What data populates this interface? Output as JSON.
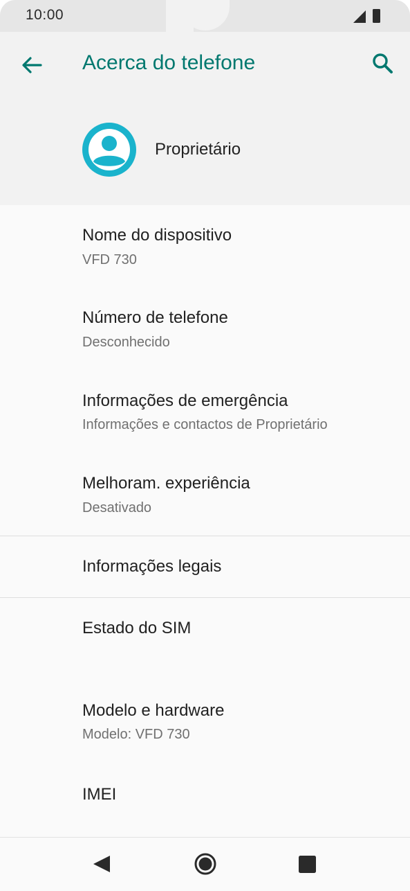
{
  "status_bar": {
    "time": "10:00"
  },
  "header": {
    "title": "Acerca do telefone",
    "back_icon": "arrow-left-icon",
    "search_icon": "search-icon",
    "accent_color": "#00786f"
  },
  "owner": {
    "name": "Proprietário",
    "avatar_icon": "account-circle-icon",
    "avatar_color": "#1ab3cc"
  },
  "items": [
    {
      "title": "Nome do dispositivo",
      "subtitle": "VFD 730"
    },
    {
      "title": "Número de telefone",
      "subtitle": "Desconhecido"
    },
    {
      "title": "Informações de emergência",
      "subtitle": "Informações e contactos de Proprietário"
    },
    {
      "title": "Melhoram. experiência",
      "subtitle": "Desativado"
    },
    {
      "title": "Informações legais",
      "subtitle": ""
    },
    {
      "title": "Estado do SIM",
      "subtitle": ""
    },
    {
      "title": "Modelo e hardware",
      "subtitle": "Modelo: VFD 730"
    },
    {
      "title": "IMEI",
      "subtitle": ""
    }
  ],
  "nav_bar": {
    "back_icon": "triangle-back-icon",
    "home_icon": "circle-home-icon",
    "recents_icon": "square-recents-icon"
  }
}
